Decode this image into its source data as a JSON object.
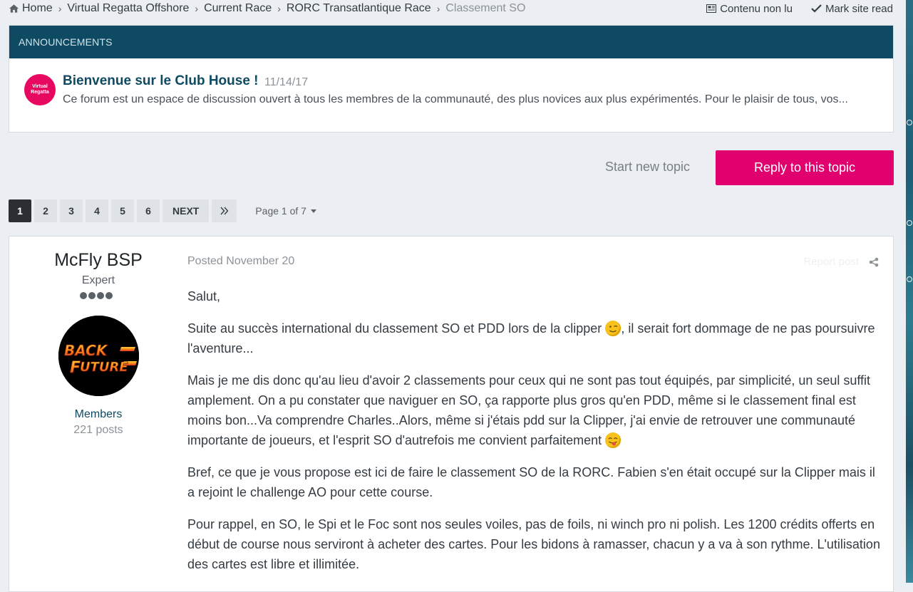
{
  "breadcrumb": {
    "items": [
      "Home",
      "Virtual Regatta Offshore",
      "Current Race",
      "RORC Transatlantique Race"
    ],
    "current": "Classement SO"
  },
  "top_links": {
    "unread": "Contenu non lu",
    "mark_read": "Mark site read"
  },
  "announcements": {
    "header": "ANNOUNCEMENTS",
    "avatar_text": "Virtual Regatta",
    "title": "Bienvenue sur le Club House !",
    "date": "11/14/17",
    "excerpt": "Ce forum est un espace de discussion ouvert à tous les membres de la communauté, des plus novices aux plus expérimentés. Pour le plaisir de tous, vos..."
  },
  "actions": {
    "start_topic": "Start new topic",
    "reply": "Reply to this topic"
  },
  "pagination": {
    "pages": [
      "1",
      "2",
      "3",
      "4",
      "5",
      "6"
    ],
    "active": "1",
    "next": "NEXT",
    "page_of": "Page 1 of 7"
  },
  "post": {
    "author": "McFly BSP",
    "rank": "Expert",
    "rank_pips": 4,
    "avatar_text": "BACK TO THE FUTURE",
    "group": "Members",
    "post_count": "221 posts",
    "posted": "Posted November 20",
    "report": "Report post",
    "paragraphs": {
      "p1": "Salut,",
      "p2a": "Suite au succès international du classement SO et PDD lors de la clipper",
      "p2b": ",  il serait fort dommage de ne pas poursuivre l'aventure...",
      "p3a": "Mais je me dis donc qu'au lieu d'avoir 2 classements pour ceux qui ne sont pas tout équipés, par simplicité, un seul suffit amplement. On a pu constater que naviguer en SO, ça rapporte plus gros qu'en PDD, même si le classement final est moins bon...Va comprendre Charles..Alors, même si j'étais pdd sur la Clipper, j'ai envie de retrouver une communauté importante de joueurs, et l'esprit SO d'autrefois me convient parfaitement",
      "p4": "Bref, ce que je vous propose est ici de faire le classement SO de la RORC. Fabien s'en était occupé sur la Clipper mais il a rejoint le challenge AO pour cette course.",
      "p5": "Pour rappel, en SO, le Spi et le Foc sont nos seules voiles, pas de foils, ni winch pro ni polish. Les 1200 crédits offerts en début de course nous serviront à acheter des cartes. Pour les bidons à ramasser, chacun y a va à son rythme. L'utilisation des cartes est libre et illimitée."
    }
  },
  "colors": {
    "brand_dark": "#0e4b63",
    "accent": "#e0006e",
    "page_bg": "#ebeef2"
  }
}
